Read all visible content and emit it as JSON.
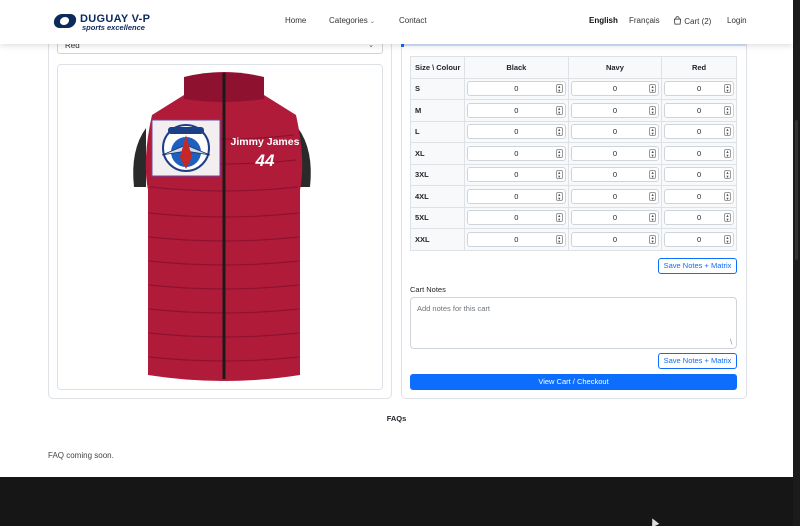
{
  "header": {
    "logo_title": "DUGUAY V-P",
    "logo_subtitle": "sports excellence",
    "nav": [
      "Home",
      "Categories",
      "Contact"
    ],
    "lang_active": "English",
    "lang_other": "Français",
    "cart_label": "Cart (2)",
    "login": "Login"
  },
  "product": {
    "colour_select": "Red",
    "print_name": "Jimmy James",
    "print_number": "44",
    "crest_text": "ARMLO",
    "vest_color": "#b11b3a"
  },
  "matrix": {
    "corner": "Size \\ Colour",
    "colours": [
      "Black",
      "Navy",
      "Red"
    ],
    "rows": [
      {
        "size": "S",
        "qty": [
          "0",
          "0",
          "0"
        ]
      },
      {
        "size": "M",
        "qty": [
          "0",
          "0",
          "0"
        ]
      },
      {
        "size": "L",
        "qty": [
          "0",
          "0",
          "0"
        ]
      },
      {
        "size": "XL",
        "qty": [
          "0",
          "0",
          "0"
        ]
      },
      {
        "size": "3XL",
        "qty": [
          "0",
          "0",
          "0"
        ]
      },
      {
        "size": "4XL",
        "qty": [
          "0",
          "0",
          "0"
        ]
      },
      {
        "size": "5XL",
        "qty": [
          "0",
          "0",
          "0"
        ]
      },
      {
        "size": "XXL",
        "qty": [
          "0",
          "0",
          "0"
        ]
      }
    ]
  },
  "actions": {
    "save_notes_matrix": "Save Notes + Matrix",
    "cart_notes_label": "Cart Notes",
    "cart_notes_placeholder": "Add notes for this cart",
    "checkout": "View Cart / Checkout"
  },
  "faq": {
    "title": "FAQs",
    "text": "FAQ coming soon."
  },
  "colors": {
    "primary": "#0d6efd",
    "brand_navy": "#0d2a5c",
    "footer": "#161616"
  }
}
